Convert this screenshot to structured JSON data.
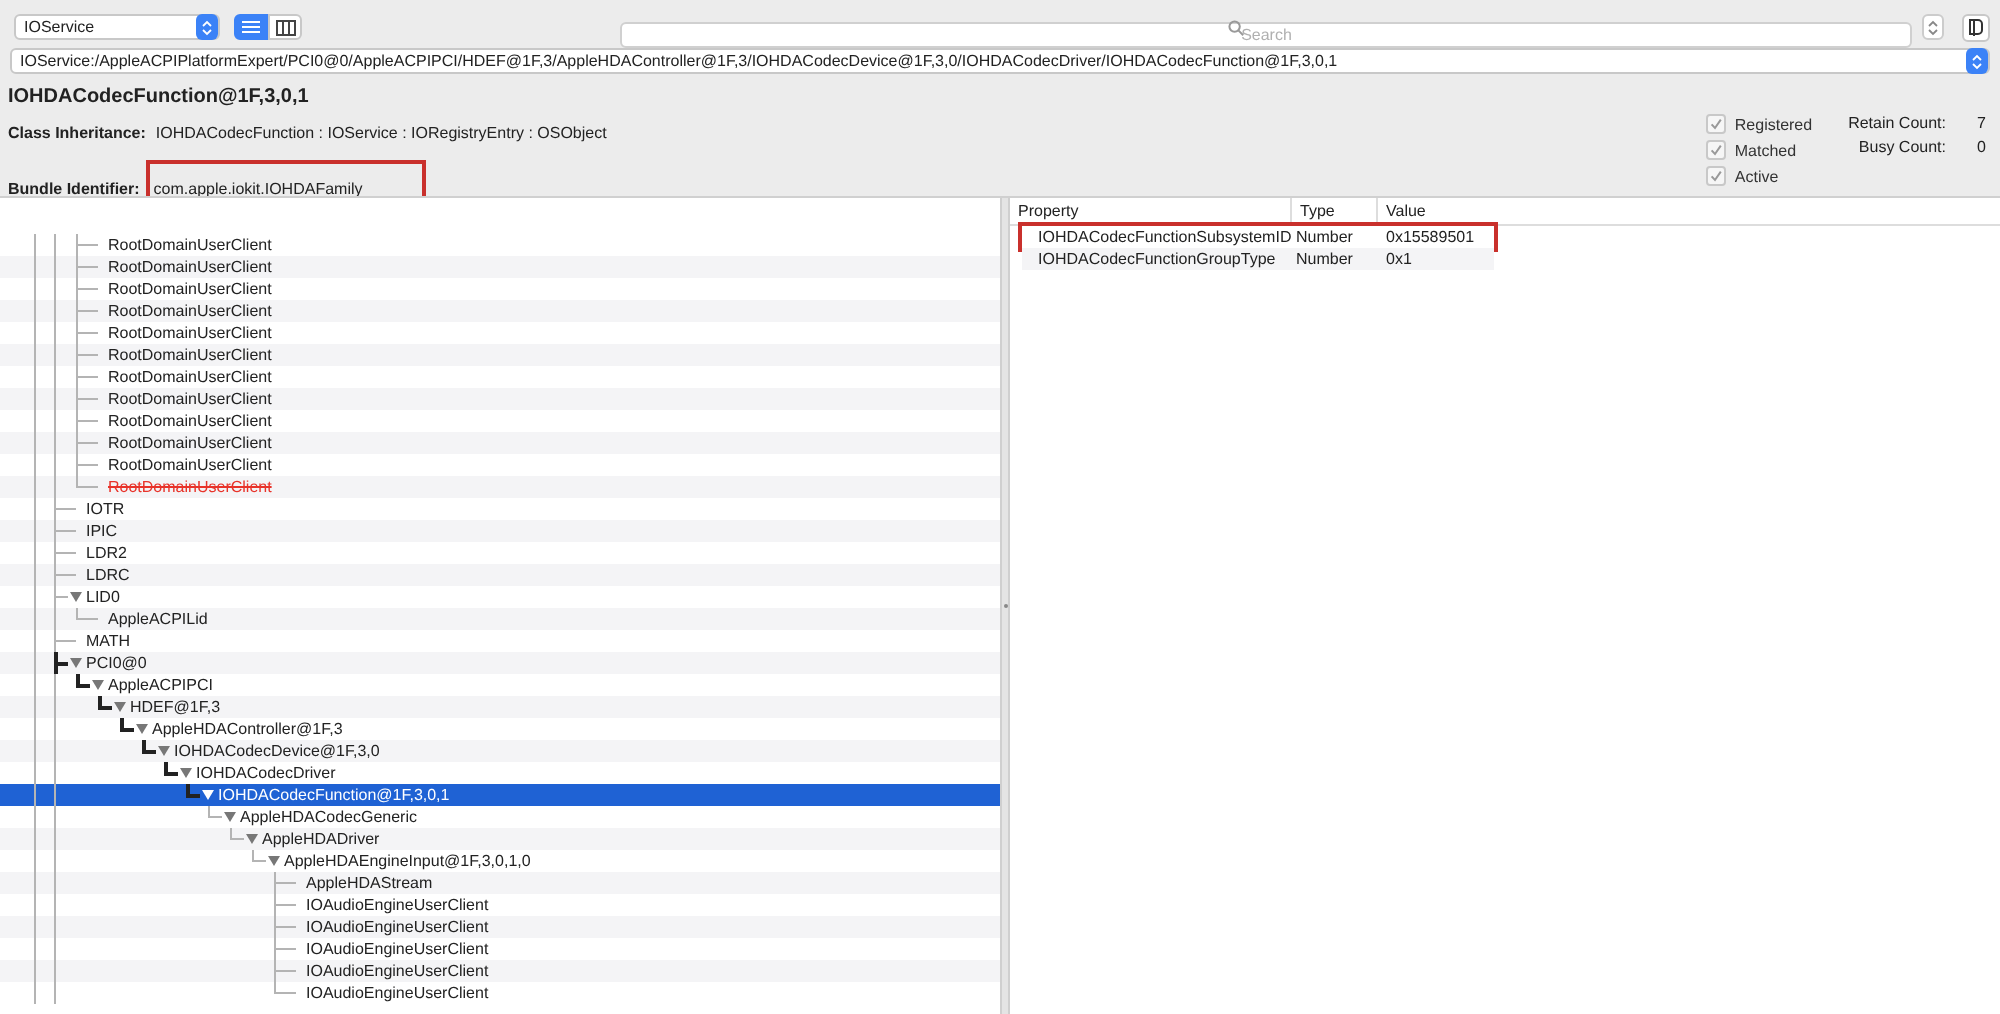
{
  "toolbar": {
    "plane": "IOService",
    "view_modes": [
      {
        "kind": "list",
        "selected": true
      },
      {
        "kind": "columns",
        "selected": false
      }
    ],
    "search": {
      "placeholder": "Search"
    }
  },
  "path": "IOService:/AppleACPIPlatformExpert/PCI0@0/AppleACPIPCI/HDEF@1F,3/AppleHDAController@1F,3/IOHDACodecDevice@1F,3,0/IOHDACodecDriver/IOHDACodecFunction@1F,3,0,1",
  "details": {
    "title": "IOHDACodecFunction@1F,3,0,1",
    "inheritance_label": "Class Inheritance:",
    "inheritance": "IOHDACodecFunction : IOService : IORegistryEntry : OSObject",
    "bundle_label": "Bundle Identifier:",
    "bundle": "com.apple.iokit.IOHDAFamily",
    "bundle_highlighted": true,
    "flags": [
      {
        "label": "Registered",
        "checked": true
      },
      {
        "label": "Matched",
        "checked": true
      },
      {
        "label": "Active",
        "checked": true
      }
    ],
    "counts": [
      {
        "label": "Retain Count:",
        "value": "7"
      },
      {
        "label": "Busy Count:",
        "value": "0"
      }
    ]
  },
  "tree": {
    "continued_children": [
      {
        "name": "RootDomainUserClient",
        "selected": false,
        "removed": false
      },
      {
        "name": "RootDomainUserClient",
        "selected": false,
        "removed": false
      },
      {
        "name": "RootDomainUserClient",
        "selected": false,
        "removed": false
      },
      {
        "name": "RootDomainUserClient",
        "selected": false,
        "removed": false
      },
      {
        "name": "RootDomainUserClient",
        "selected": false,
        "removed": false
      },
      {
        "name": "RootDomainUserClient",
        "selected": false,
        "removed": false
      },
      {
        "name": "RootDomainUserClient",
        "selected": false,
        "removed": false
      },
      {
        "name": "RootDomainUserClient",
        "selected": false,
        "removed": false
      },
      {
        "name": "RootDomainUserClient",
        "selected": false,
        "removed": false
      },
      {
        "name": "RootDomainUserClient",
        "selected": false,
        "removed": false
      },
      {
        "name": "RootDomainUserClient",
        "selected": false,
        "removed": false
      },
      {
        "name": "RootDomainUserClient",
        "selected": false,
        "removed": true
      }
    ],
    "items": [
      {
        "name": "IOTR",
        "selected": false
      },
      {
        "name": "IPIC",
        "selected": false
      },
      {
        "name": "LDR2",
        "selected": false
      },
      {
        "name": "LDRC",
        "selected": false
      },
      {
        "name": "LID0",
        "selected": false,
        "expanded": true,
        "children": [
          {
            "name": "AppleACPILid",
            "selected": false
          }
        ]
      },
      {
        "name": "MATH",
        "selected": false
      },
      {
        "name": "PCI0@0",
        "selected": false,
        "expanded": true,
        "children": [
          {
            "name": "AppleACPIPCI",
            "selected": false,
            "expanded": true,
            "children": [
              {
                "name": "HDEF@1F,3",
                "selected": false,
                "expanded": true,
                "children": [
                  {
                    "name": "AppleHDAController@1F,3",
                    "selected": false,
                    "expanded": true,
                    "children": [
                      {
                        "name": "IOHDACodecDevice@1F,3,0",
                        "selected": false,
                        "expanded": true,
                        "children": [
                          {
                            "name": "IOHDACodecDriver",
                            "selected": false,
                            "expanded": true,
                            "children": [
                              {
                                "name": "IOHDACodecFunction@1F,3,0,1",
                                "selected": true,
                                "expanded": true,
                                "children": [
                                  {
                                    "name": "AppleHDACodecGeneric",
                                    "selected": false,
                                    "expanded": true,
                                    "children": [
                                      {
                                        "name": "AppleHDADriver",
                                        "selected": false,
                                        "expanded": true,
                                        "children": [
                                          {
                                            "name": "AppleHDAEngineInput@1F,3,0,1,0",
                                            "selected": false,
                                            "expanded": true,
                                            "children": [
                                              {
                                                "name": "AppleHDAStream",
                                                "selected": false
                                              },
                                              {
                                                "name": "IOAudioEngineUserClient",
                                                "selected": false
                                              },
                                              {
                                                "name": "IOAudioEngineUserClient",
                                                "selected": false
                                              },
                                              {
                                                "name": "IOAudioEngineUserClient",
                                                "selected": false
                                              },
                                              {
                                                "name": "IOAudioEngineUserClient",
                                                "selected": false
                                              },
                                              {
                                                "name": "IOAudioEngineUserClient",
                                                "selected": false
                                              }
                                            ]
                                          }
                                        ]
                                      }
                                    ]
                                  }
                                ]
                              }
                            ]
                          }
                        ]
                      }
                    ]
                  }
                ]
              }
            ]
          }
        ]
      }
    ]
  },
  "properties": {
    "columns": [
      "Property",
      "Type",
      "Value"
    ],
    "rows": [
      {
        "property": "IOHDACodecFunctionSubsystemID",
        "type": "Number",
        "value": "0x15589501",
        "highlighted": true
      },
      {
        "property": "IOHDACodecFunctionGroupType",
        "type": "Number",
        "value": "0x1",
        "highlighted": false
      }
    ]
  }
}
